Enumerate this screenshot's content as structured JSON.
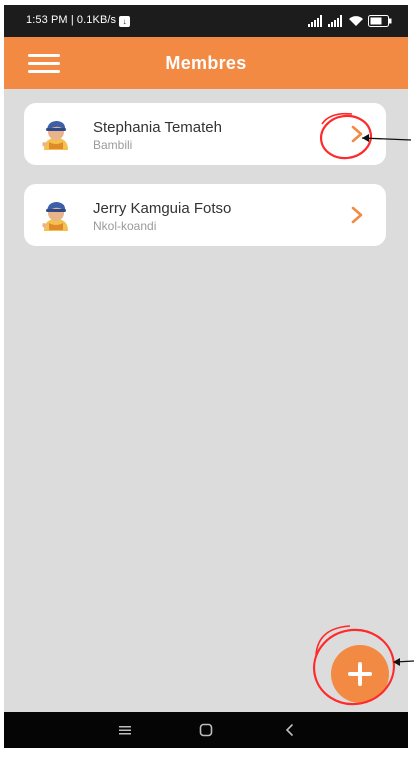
{
  "status_bar": {
    "time_speed": "1:53 PM | 0.1KB/s",
    "badge_glyph": "↓",
    "icons": [
      "signal-icon",
      "signal-icon",
      "wifi-icon",
      "battery-icon"
    ]
  },
  "app_bar": {
    "title": "Membres",
    "menu_icon": "hamburger-menu-icon",
    "color": "#f38a44"
  },
  "members": [
    {
      "name": "Stephania Temateh",
      "location": "Bambili",
      "avatar_icon": "avatar-icon",
      "chevron_icon": "chevron-right-icon"
    },
    {
      "name": "Jerry Kamguia Fotso",
      "location": "Nkol-koandi",
      "avatar_icon": "avatar-icon",
      "chevron_icon": "chevron-right-icon"
    }
  ],
  "fab": {
    "icon": "plus-icon"
  },
  "nav_bar": {
    "icons": [
      "menu-icon",
      "home-icon",
      "back-icon"
    ]
  },
  "annotations": {
    "marker_color": "#ff2a2a"
  },
  "colors": {
    "accent": "#f38a44",
    "background": "#dcdcdc",
    "card": "#ffffff"
  }
}
